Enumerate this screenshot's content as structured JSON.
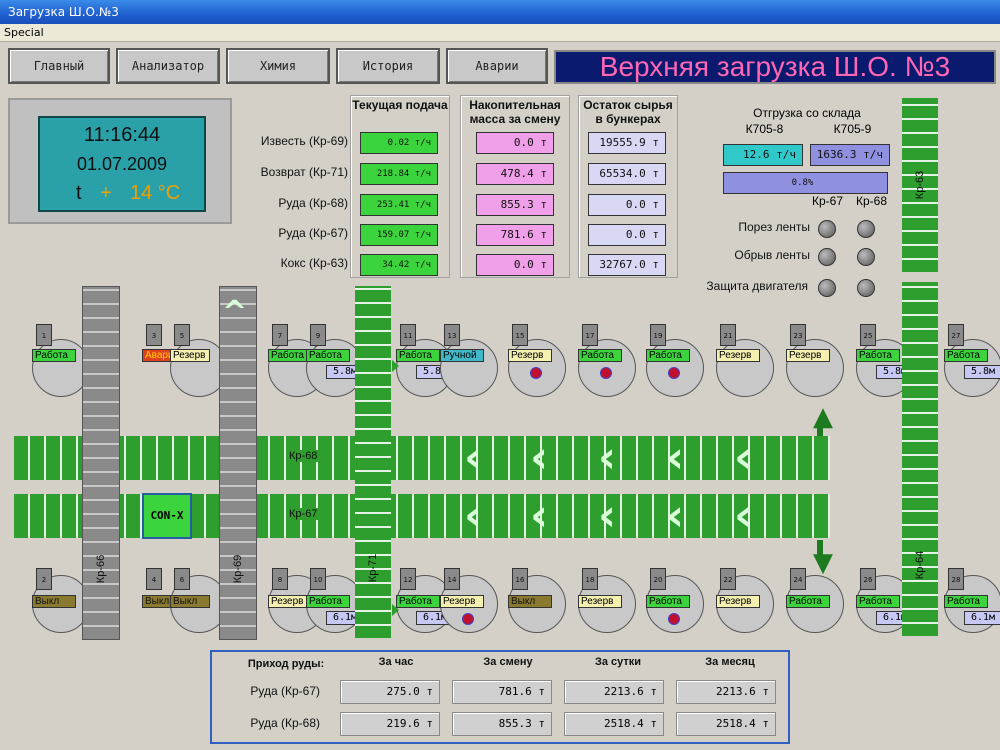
{
  "window": {
    "title": "Загрузка Ш.О.№3",
    "menu": "Special"
  },
  "nav": {
    "items": [
      "Главный",
      "Анализатор",
      "Химия",
      "История",
      "Аварии"
    ],
    "page_title": "Верхняя загрузка Ш.О. №3"
  },
  "clock": {
    "time": "11:16:44",
    "date": "01.07.2009",
    "t_label": "t",
    "t_plus": "+",
    "temp": "14 °C"
  },
  "feed": {
    "headers": [
      "Текущая подача",
      "Накопительная масса за смену",
      "Остаток сырья в бункерах"
    ],
    "rows": [
      {
        "label": "Известь (Кр-69)",
        "current": "0.02 т/ч",
        "accum": "0.0 т",
        "remain": "19555.9 т"
      },
      {
        "label": "Возврат (Кр-71)",
        "current": "218.84 т/ч",
        "accum": "478.4 т",
        "remain": "65534.0 т"
      },
      {
        "label": "Руда (Кр-68)",
        "current": "253.41 т/ч",
        "accum": "855.3 т",
        "remain": "0.0 т"
      },
      {
        "label": "Руда (Кр-67)",
        "current": "159.07 т/ч",
        "accum": "781.6 т",
        "remain": "0.0 т"
      },
      {
        "label": "Кокс (Кр-63)",
        "current": "34.42 т/ч",
        "accum": "0.0 т",
        "remain": "32767.0 т"
      }
    ]
  },
  "shipping": {
    "title": "Отгрузка со склада",
    "k1": "К705-8",
    "k2": "К705-9",
    "v1": "12.6 т/ч",
    "v2": "1636.3 т/ч",
    "pct": "0.8%",
    "kr1": "Кр-67",
    "kr2": "Кр-68",
    "alarms": [
      "Порез ленты",
      "Обрыв ленты",
      "Защита двигателя"
    ]
  },
  "belts": {
    "kr68": "Кр-68",
    "kr67": "Кр-67",
    "kr66": "Кр-66",
    "kr69": "Кр-69",
    "kr71": "Кр-71",
    "kr63": "Кр-63",
    "kr64": "Кр-64",
    "conx": "CON-X"
  },
  "top_bunkers": [
    {
      "num": "1",
      "status": "Работа",
      "type": "work"
    },
    {
      "num": "3",
      "status": "Авария",
      "type": "alarm"
    },
    {
      "num": "5",
      "status": "Резерв",
      "type": "res"
    },
    {
      "num": "7",
      "status": "Работа",
      "type": "work"
    },
    {
      "num": "9",
      "status": "Работа",
      "type": "work",
      "level": "5.8м"
    },
    {
      "num": "11",
      "status": "Работа",
      "type": "work",
      "level": "5.8м"
    },
    {
      "num": "13",
      "status": "Ручной",
      "type": "man"
    },
    {
      "num": "15",
      "status": "Резерв",
      "type": "res"
    },
    {
      "num": "17",
      "status": "Работа",
      "type": "work"
    },
    {
      "num": "19",
      "status": "Работа",
      "type": "work"
    },
    {
      "num": "21",
      "status": "Резерв",
      "type": "res"
    },
    {
      "num": "23",
      "status": "Резерв",
      "type": "res"
    },
    {
      "num": "25",
      "status": "Работа",
      "type": "work",
      "level": "5.8м"
    },
    {
      "num": "27",
      "status": "Работа",
      "type": "work",
      "level": "5.8м"
    }
  ],
  "bottom_bunkers": [
    {
      "num": "2",
      "status": "Выкл",
      "type": "off"
    },
    {
      "num": "4",
      "status": "Выкл",
      "type": "off"
    },
    {
      "num": "6",
      "status": "Выкл",
      "type": "off"
    },
    {
      "num": "8",
      "status": "Резерв",
      "type": "res"
    },
    {
      "num": "10",
      "status": "Работа",
      "type": "work",
      "level": "6.1м"
    },
    {
      "num": "12",
      "status": "Работа",
      "type": "work",
      "level": "6.1м"
    },
    {
      "num": "14",
      "status": "Резерв",
      "type": "res"
    },
    {
      "num": "16",
      "status": "Выкл",
      "type": "off"
    },
    {
      "num": "18",
      "status": "Резерв",
      "type": "res"
    },
    {
      "num": "20",
      "status": "Работа",
      "type": "work"
    },
    {
      "num": "22",
      "status": "Резерв",
      "type": "res"
    },
    {
      "num": "24",
      "status": "Работа",
      "type": "work"
    },
    {
      "num": "26",
      "status": "Работа",
      "type": "work",
      "level": "6.1м"
    },
    {
      "num": "28",
      "status": "Работа",
      "type": "work",
      "level": "6.1м"
    }
  ],
  "arrival": {
    "title": "Приход руды:",
    "cols": [
      "За час",
      "За смену",
      "За сутки",
      "За месяц"
    ],
    "rows": [
      {
        "label": "Руда (Кр-67)",
        "values": [
          "275.0 т",
          "781.6 т",
          "2213.6 т",
          "2213.6 т"
        ]
      },
      {
        "label": "Руда (Кр-68)",
        "values": [
          "219.6 т",
          "855.3 т",
          "2518.4 т",
          "2518.4 т"
        ]
      }
    ]
  },
  "colors": {
    "belt": "#2e9e2e",
    "title_bg": "#0a1a6e",
    "title_fg": "#ff66b4"
  }
}
